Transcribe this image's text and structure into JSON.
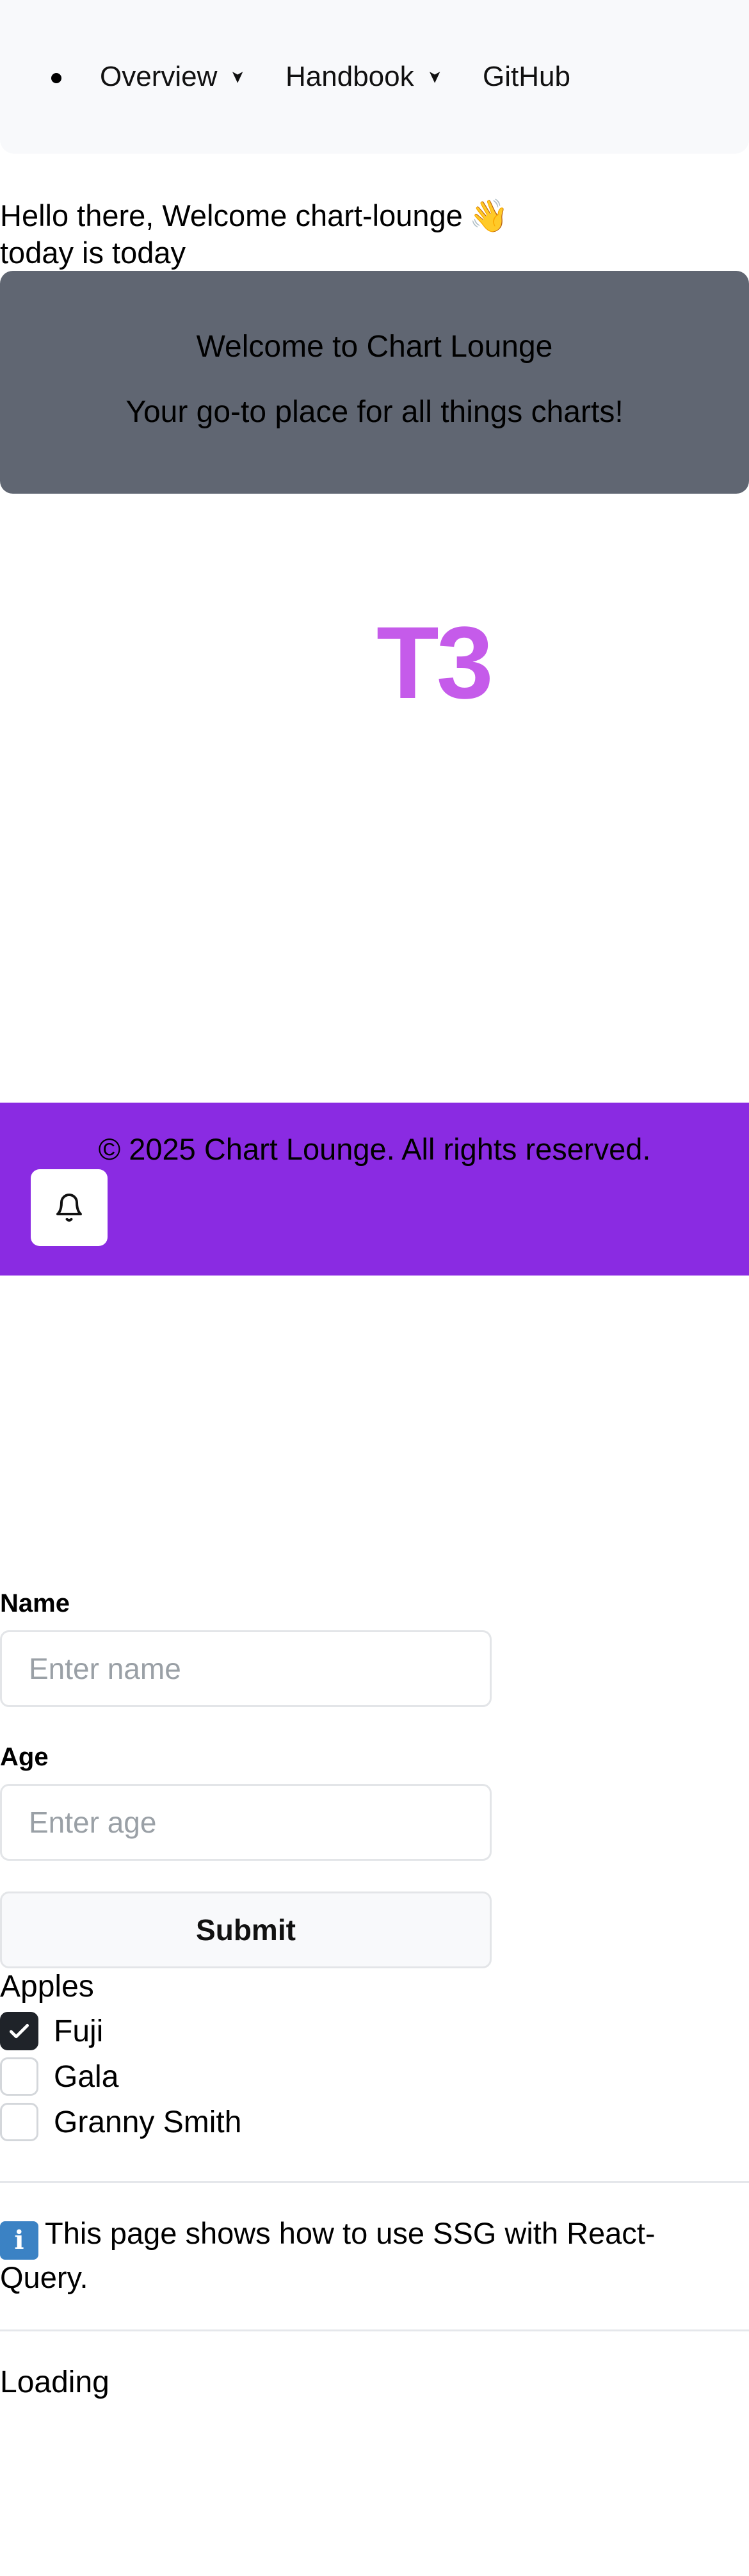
{
  "nav": {
    "items": [
      {
        "label": "Overview",
        "has_dropdown": true,
        "icon": "chevron-right-icon"
      },
      {
        "label": "Handbook",
        "has_dropdown": true,
        "icon": "chevron-right-icon"
      },
      {
        "label": "GitHub",
        "has_dropdown": false
      }
    ]
  },
  "greeting": {
    "line1": "Hello there, Welcome chart-lounge",
    "emoji": "👋",
    "line2": "today is today"
  },
  "hero": {
    "title": "Welcome to Chart Lounge",
    "subtitle": "Your go-to place for all things charts!",
    "background": "#606672"
  },
  "logo": {
    "text": "T3",
    "color": "#c55bea"
  },
  "footer": {
    "copyright": "© 2025 Chart Lounge. All rights reserved.",
    "background": "#8a2be2",
    "bell_icon": "bell-icon"
  },
  "form": {
    "name_label": "Name",
    "name_placeholder": "Enter name",
    "name_value": "",
    "age_label": "Age",
    "age_placeholder": "Enter age",
    "age_value": "",
    "submit_label": "Submit"
  },
  "checkbox_group": {
    "legend": "Apples",
    "options": [
      {
        "label": "Fuji",
        "checked": true
      },
      {
        "label": "Gala",
        "checked": false
      },
      {
        "label": "Granny Smith",
        "checked": false
      }
    ]
  },
  "info": {
    "icon": "ℹ️",
    "text": "This page shows how to use SSG with React-Query."
  },
  "status": {
    "loading": "Loading"
  }
}
